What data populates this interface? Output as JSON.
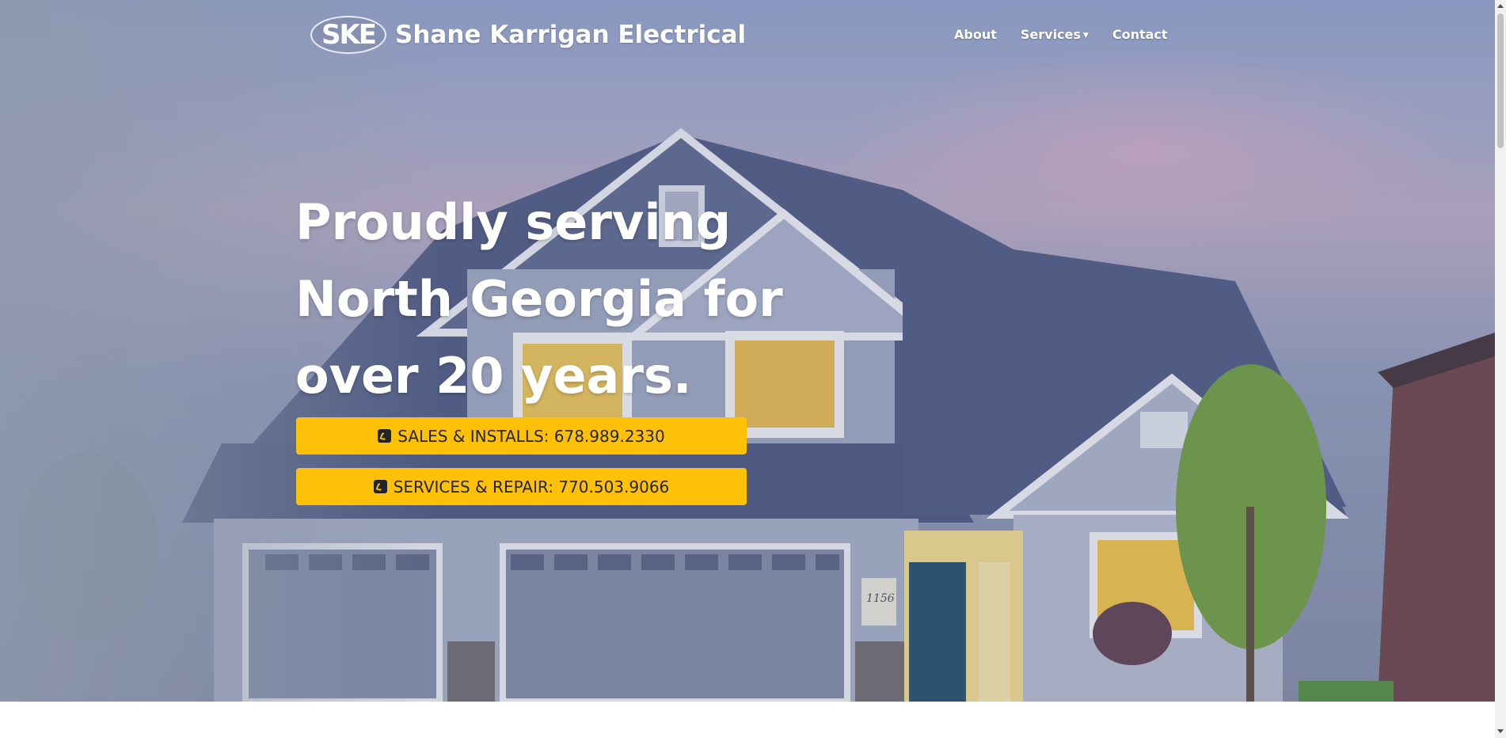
{
  "brand": {
    "logo_text": "SKE",
    "name": "Shane Karrigan Electrical"
  },
  "nav": {
    "items": [
      {
        "label": "About"
      },
      {
        "label": "Services"
      },
      {
        "label": "Contact"
      }
    ]
  },
  "hero": {
    "headline_lines": [
      "Proudly serving",
      "North Georgia for",
      "over 20 years."
    ],
    "house_number": "1156",
    "buttons": {
      "sales": "SALES & INSTALLS: 678.989.2330",
      "service": "SERVICES & REPAIR: 770.503.9066"
    }
  },
  "icons": {
    "phone": "phone-square-icon",
    "dropdown": "caret-down-icon"
  },
  "colors": {
    "accent": "#ffc107",
    "text_on_accent": "#212529",
    "nav_text": "#ffffff"
  }
}
